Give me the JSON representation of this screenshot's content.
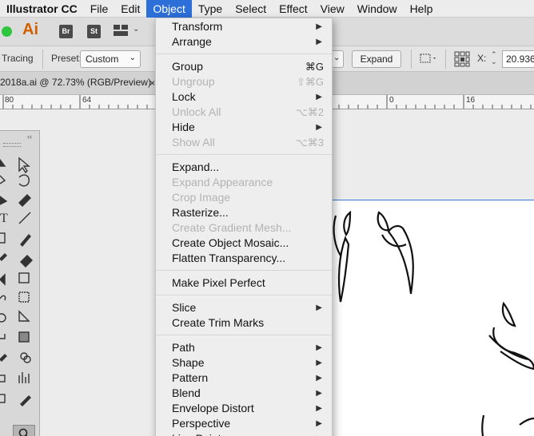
{
  "menubar": {
    "app": "Illustrator CC",
    "items": [
      "File",
      "Edit",
      "Object",
      "Type",
      "Select",
      "Effect",
      "View",
      "Window",
      "Help"
    ],
    "active": "Object"
  },
  "appbar": {
    "logo": "Ai",
    "br": "Br",
    "st": "St"
  },
  "controlbar": {
    "tracing": "Tracing",
    "preset_label": "Preset:",
    "preset_value": "Custom",
    "expand": "Expand",
    "x_label": "X:",
    "x_value": "20.936"
  },
  "document": {
    "tab_title": "2018a.ai @ 72.73% (RGB/Preview)",
    "close": "×"
  },
  "ruler": {
    "ticks": [
      "80",
      "64",
      "0",
      "16"
    ]
  },
  "menu": {
    "items": [
      {
        "label": "Transform",
        "submenu": true,
        "enabled": true
      },
      {
        "label": "Arrange",
        "submenu": true,
        "enabled": true
      },
      {
        "separator": true
      },
      {
        "label": "Group",
        "shortcut": "⌘G",
        "enabled": true
      },
      {
        "label": "Ungroup",
        "shortcut": "⇧⌘G",
        "enabled": false
      },
      {
        "label": "Lock",
        "submenu": true,
        "enabled": true
      },
      {
        "label": "Unlock All",
        "shortcut": "⌥⌘2",
        "enabled": false
      },
      {
        "label": "Hide",
        "submenu": true,
        "enabled": true
      },
      {
        "label": "Show All",
        "shortcut": "⌥⌘3",
        "enabled": false
      },
      {
        "separator": true
      },
      {
        "label": "Expand...",
        "enabled": true
      },
      {
        "label": "Expand Appearance",
        "enabled": false
      },
      {
        "label": "Crop Image",
        "enabled": false
      },
      {
        "label": "Rasterize...",
        "enabled": true
      },
      {
        "label": "Create Gradient Mesh...",
        "enabled": false
      },
      {
        "label": "Create Object Mosaic...",
        "enabled": true
      },
      {
        "label": "Flatten Transparency...",
        "enabled": true
      },
      {
        "separator": true
      },
      {
        "label": "Make Pixel Perfect",
        "enabled": true
      },
      {
        "separator": true
      },
      {
        "label": "Slice",
        "submenu": true,
        "enabled": true
      },
      {
        "label": "Create Trim Marks",
        "enabled": true
      },
      {
        "separator": true
      },
      {
        "label": "Path",
        "submenu": true,
        "enabled": true
      },
      {
        "label": "Shape",
        "submenu": true,
        "enabled": true
      },
      {
        "label": "Pattern",
        "submenu": true,
        "enabled": true
      },
      {
        "label": "Blend",
        "submenu": true,
        "enabled": true
      },
      {
        "label": "Envelope Distort",
        "submenu": true,
        "enabled": true
      },
      {
        "label": "Perspective",
        "submenu": true,
        "enabled": true
      },
      {
        "label": "Live Paint",
        "submenu": true,
        "enabled": true
      }
    ]
  },
  "colors": {
    "menu_highlight": "#2d6fd9",
    "guide": "#3a74d6"
  }
}
